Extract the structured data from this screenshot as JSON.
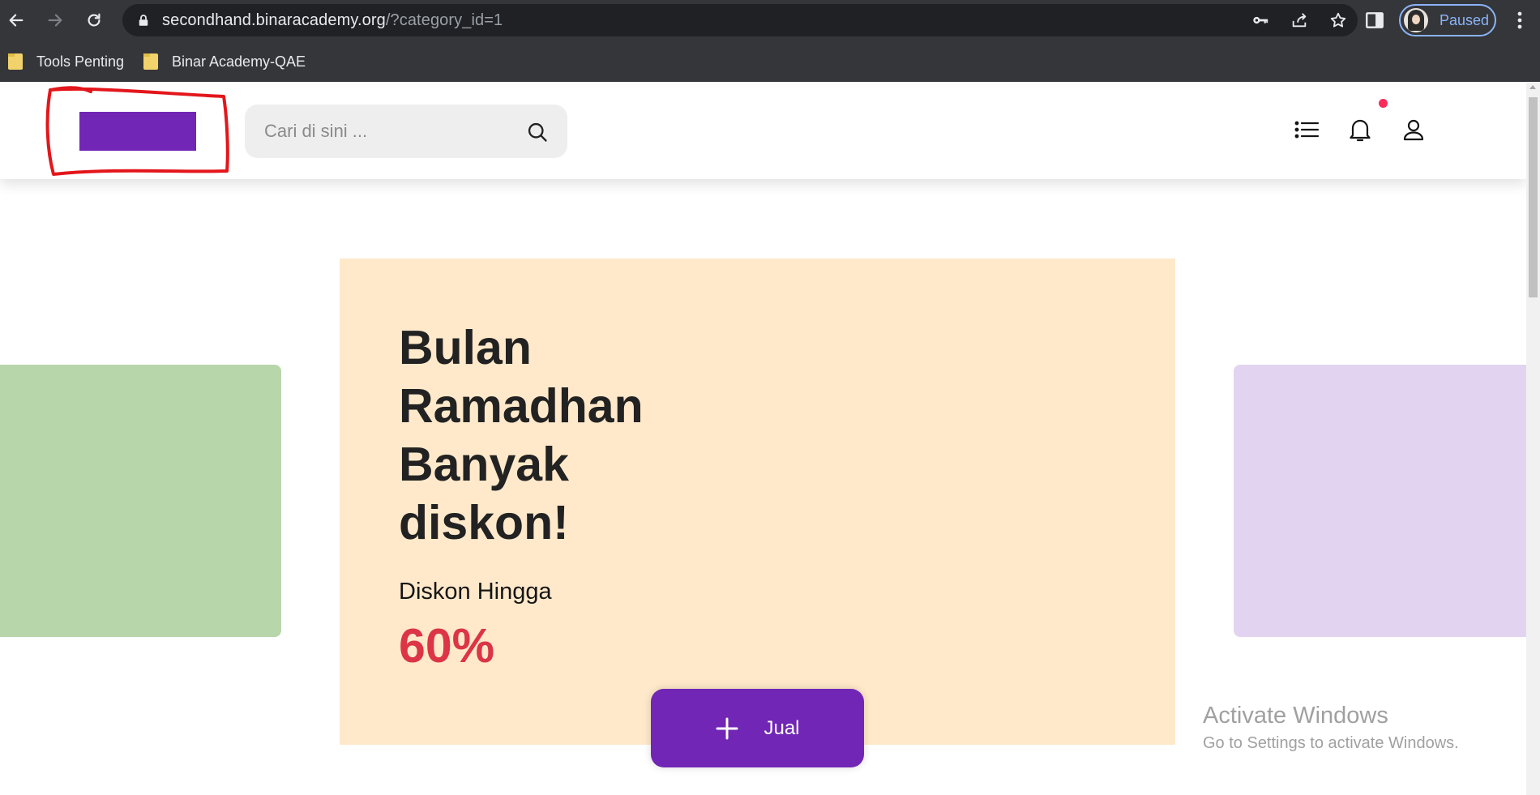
{
  "browser": {
    "url_host": "secondhand.binaracademy.org",
    "url_path": "/?category_id=1",
    "profile_status": "Paused",
    "bookmarks": [
      {
        "label": "Tools Penting"
      },
      {
        "label": "Binar Academy-QAE"
      }
    ]
  },
  "header": {
    "search_placeholder": "Cari di sini ...",
    "logo_color": "#7126b5"
  },
  "banner": {
    "title_lines": [
      "Bulan",
      "Ramadhan",
      "Banyak",
      "diskon!"
    ],
    "subtitle": "Diskon Hingga",
    "percent": "60%",
    "main_color": "#ffe9ca",
    "left_color": "#b7d6a9",
    "right_color": "#e2d4f0",
    "percent_color": "#dc3545"
  },
  "sell_button": {
    "label": "Jual",
    "color": "#7126b5"
  },
  "watermark": {
    "line1": "Activate Windows",
    "line2": "Go to Settings to activate Windows."
  }
}
